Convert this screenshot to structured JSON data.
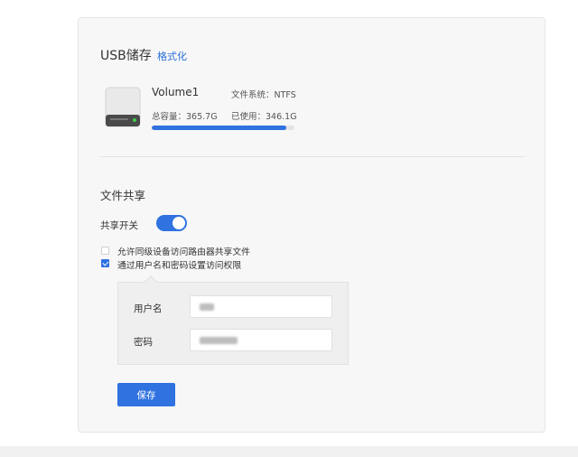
{
  "usb": {
    "title": "USB储存",
    "format_link": "格式化",
    "volume": {
      "name": "Volume1",
      "filesystem": "文件系统：NTFS",
      "total": "总容量：365.7G",
      "used": "已使用：346.1G",
      "usage_fraction": 0.946
    }
  },
  "share": {
    "title": "文件共享",
    "toggle_label": "共享开关",
    "toggle_on": true,
    "options": [
      {
        "label": "允许同级设备访问路由器共享文件",
        "checked": false
      },
      {
        "label": "通过用户名和密码设置访问权限",
        "checked": true
      }
    ],
    "username_label": "用户名",
    "password_label": "密码",
    "save_label": "保存"
  },
  "colors": {
    "accent": "#2f72e0",
    "link": "#2b6fd6"
  }
}
